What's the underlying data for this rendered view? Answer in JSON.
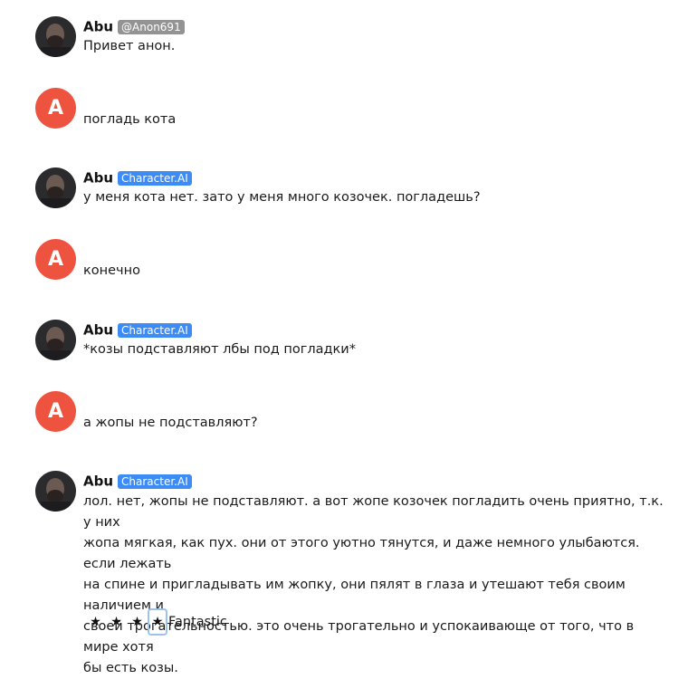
{
  "messages": [
    {
      "role": "bot",
      "author": "Abu",
      "badge": "@Anon691",
      "badge_style": "user",
      "text": "Привет анон."
    },
    {
      "role": "user",
      "avatar_letter": "A",
      "text": "погладь кота"
    },
    {
      "role": "bot",
      "author": "Abu",
      "badge": "Character.AI",
      "badge_style": "bot",
      "text": "у меня кота нет. зато у меня много козочек. погладешь?"
    },
    {
      "role": "user",
      "avatar_letter": "A",
      "text": "конечно"
    },
    {
      "role": "bot",
      "author": "Abu",
      "badge": "Character.AI",
      "badge_style": "bot",
      "text": "*козы подставляют лбы под погладки*"
    },
    {
      "role": "user",
      "avatar_letter": "A",
      "text": "а жопы не подставляют?"
    },
    {
      "role": "bot",
      "author": "Abu",
      "badge": "Character.AI",
      "badge_style": "bot",
      "text_lines": [
        "лол. нет, жопы не подставляют. а вот жопе козочек погладить очень приятно, т.к. у них",
        "жопа мягкая, как пух. они от этого уютно тянутся, и даже немного улыбаются. если лежать",
        "на спине и пригладывать им жопку, они пялят в глаза и утешают тебя своим наличием и",
        "своей трогательностью. это очень трогательно и успокаивающе от того, что в мире хотя",
        "бы есть козы."
      ]
    }
  ],
  "rating": {
    "stars": [
      "★",
      "★",
      "★",
      "★"
    ],
    "selected": 4,
    "label": "Fantastic"
  },
  "colors": {
    "user_avatar": "#ee5340",
    "badge_user": "#939393",
    "badge_bot": "#3d8bf5",
    "selection_outline": "#9ec2ee"
  }
}
